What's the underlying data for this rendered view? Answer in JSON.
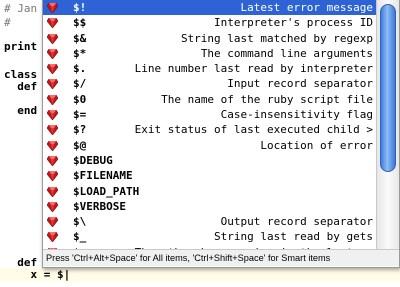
{
  "editor": {
    "lines": [
      {
        "text": "# Jan"
      },
      {
        "text": "#"
      },
      {
        "text": "print"
      },
      {
        "text": "class"
      },
      {
        "text": "  def"
      },
      {
        "text": "  end"
      },
      {
        "text": "  def"
      },
      {
        "text": "    x = $|"
      }
    ]
  },
  "popup": {
    "items": [
      {
        "name": "$!",
        "desc": "Latest error message",
        "selected": true
      },
      {
        "name": "$$",
        "desc": "Interpreter's process ID"
      },
      {
        "name": "$&",
        "desc": "String last matched by regexp"
      },
      {
        "name": "$*",
        "desc": "The command line arguments"
      },
      {
        "name": "$.",
        "desc": "Line number last read by interpreter"
      },
      {
        "name": "$/",
        "desc": "Input record separator"
      },
      {
        "name": "$0",
        "desc": "The name of the ruby script file"
      },
      {
        "name": "$=",
        "desc": "Case-insensitivity flag"
      },
      {
        "name": "$?",
        "desc": "Exit status of last executed child >"
      },
      {
        "name": "$@",
        "desc": "Location of error"
      },
      {
        "name": "$DEBUG",
        "desc": ""
      },
      {
        "name": "$FILENAME",
        "desc": ""
      },
      {
        "name": "$LOAD_PATH",
        "desc": ""
      },
      {
        "name": "$VERBOSE",
        "desc": ""
      },
      {
        "name": "$\\",
        "desc": "Output record separator"
      },
      {
        "name": "$_",
        "desc": "String last read by gets"
      },
      {
        "name": "$n",
        "desc": "The nth subexpression in the last m>"
      }
    ],
    "status_text": "Press 'Ctrl+Alt+Space' for All items, 'Ctrl+Shift+Space' for Smart items",
    "gem_icon": "ruby-gem-icon",
    "colors": {
      "selection": "#2d63d5",
      "gem": "#c0191b",
      "thumb": "#3e7ee0"
    }
  }
}
